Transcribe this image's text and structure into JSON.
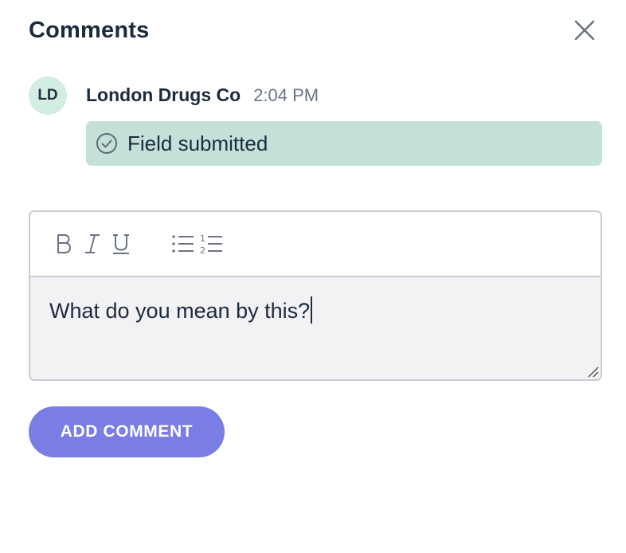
{
  "header": {
    "title": "Comments",
    "close_icon": "close-icon"
  },
  "comment": {
    "avatar_initials": "LD",
    "author": "London Drugs Co",
    "time": "2:04 PM",
    "status_text": "Field submitted",
    "status_icon": "check-circle-icon",
    "status_bg": "#c3e1d8"
  },
  "editor": {
    "toolbar": [
      "bold-icon",
      "italic-icon",
      "underline-icon",
      "bullet-list-icon",
      "numbered-list-icon"
    ],
    "value": "What do you mean by this?"
  },
  "actions": {
    "add_comment_label": "ADD COMMENT",
    "accent": "#7a7de3"
  }
}
